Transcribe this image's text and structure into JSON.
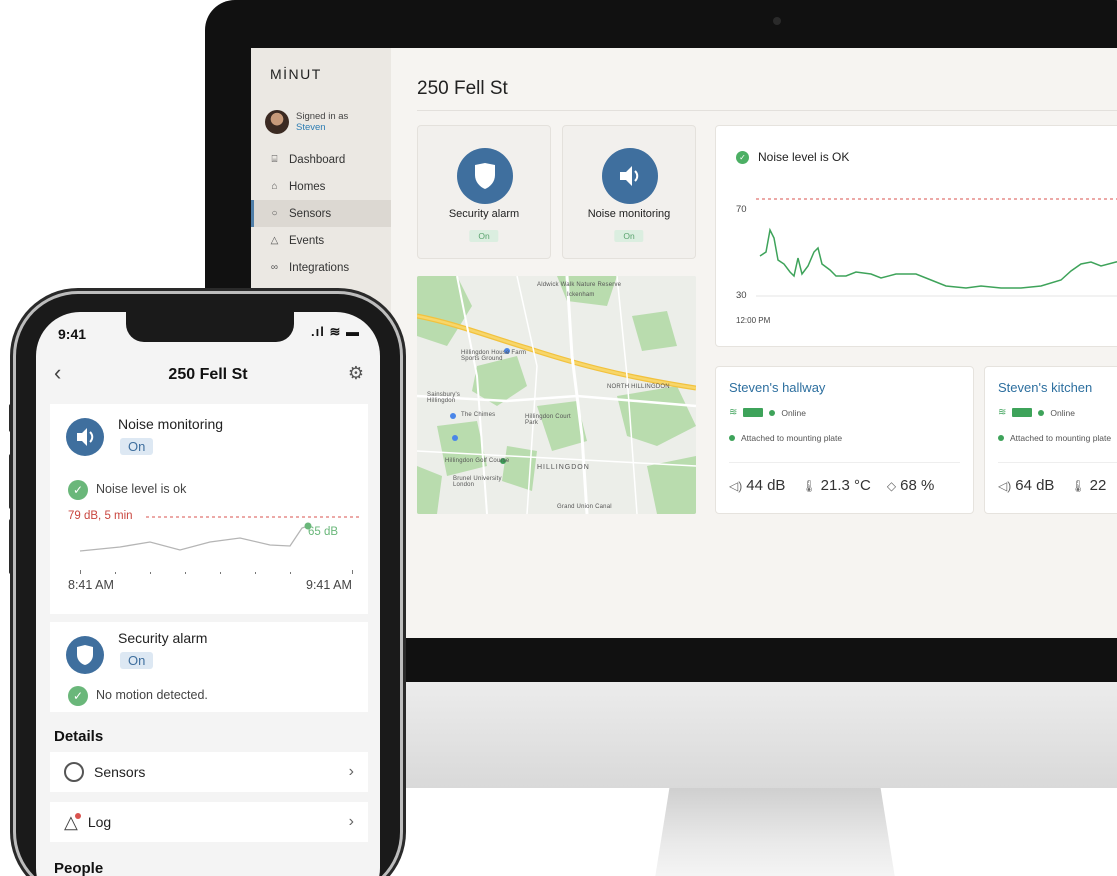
{
  "imac": {
    "brand": "MİNUT",
    "user": {
      "signed_in_as": "Signed in as",
      "name": "Steven"
    },
    "nav": [
      {
        "label": "Dashboard",
        "icon": "dashboard-icon"
      },
      {
        "label": "Homes",
        "icon": "home-icon"
      },
      {
        "label": "Sensors",
        "icon": "sensor-icon"
      },
      {
        "label": "Events",
        "icon": "bell-icon"
      },
      {
        "label": "Integrations",
        "icon": "link-icon"
      }
    ],
    "active_nav": "Sensors",
    "page_title": "250 Fell St",
    "modes": [
      {
        "label": "Security alarm",
        "status": "On",
        "icon": "shield-icon"
      },
      {
        "label": "Noise monitoring",
        "status": "On",
        "icon": "speaker-icon"
      }
    ],
    "map_labels": [
      "Hillingdon House Farm Sports Ground",
      "NORTH HILLINGDON",
      "Sainsbury's Hillingdon",
      "The Chimes",
      "Hillingdon Court Park",
      "Hillingdon Golf Course",
      "HILLINGDON",
      "Brunel University London",
      "Grand Union Canal",
      "Aldwick Walk Nature Reserve",
      "Ickenham"
    ],
    "noise_card": {
      "status": "Noise level is OK",
      "y_top": "70",
      "y_bottom": "30",
      "x_start": "12:00 PM"
    },
    "devices": [
      {
        "name": "Steven's hallway",
        "online": "Online",
        "mount": "Attached to mounting plate",
        "noise": "44 dB",
        "temp": "21.3 °C",
        "humidity": "68 %"
      },
      {
        "name": "Steven's kitchen",
        "online": "Online",
        "mount": "Attached to mounting plate",
        "noise": "64 dB",
        "temp": "22"
      }
    ]
  },
  "phone": {
    "time": "9:41",
    "title": "250 Fell St",
    "noise": {
      "label": "Noise monitoring",
      "status": "On",
      "ok_text": "Noise level is ok",
      "threshold": "79 dB, 5 min",
      "current": "65 dB",
      "x_start": "8:41 AM",
      "x_end": "9:41 AM"
    },
    "alarm": {
      "label": "Security alarm",
      "status": "On",
      "motion_text": "No motion detected."
    },
    "details_header": "Details",
    "rows": [
      {
        "label": "Sensors"
      },
      {
        "label": "Log"
      }
    ],
    "people_header": "People"
  },
  "colors": {
    "accent": "#3f6f9e",
    "ok_green": "#4caf64",
    "chart_green": "#3ea35a",
    "threshold_red": "#d9534f"
  }
}
